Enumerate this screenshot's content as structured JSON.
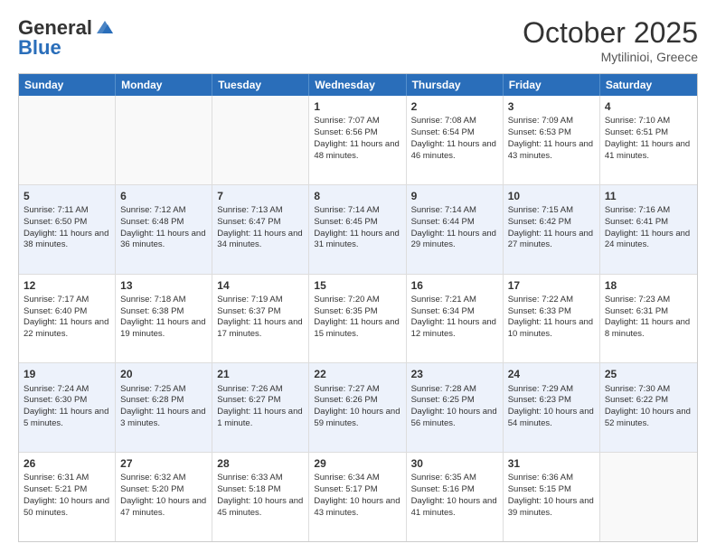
{
  "logo": {
    "general": "General",
    "blue": "Blue"
  },
  "header": {
    "month": "October 2025",
    "location": "Mytilinioi, Greece"
  },
  "days": [
    "Sunday",
    "Monday",
    "Tuesday",
    "Wednesday",
    "Thursday",
    "Friday",
    "Saturday"
  ],
  "rows": [
    [
      {
        "num": "",
        "info": ""
      },
      {
        "num": "",
        "info": ""
      },
      {
        "num": "",
        "info": ""
      },
      {
        "num": "1",
        "info": "Sunrise: 7:07 AM\nSunset: 6:56 PM\nDaylight: 11 hours and 48 minutes."
      },
      {
        "num": "2",
        "info": "Sunrise: 7:08 AM\nSunset: 6:54 PM\nDaylight: 11 hours and 46 minutes."
      },
      {
        "num": "3",
        "info": "Sunrise: 7:09 AM\nSunset: 6:53 PM\nDaylight: 11 hours and 43 minutes."
      },
      {
        "num": "4",
        "info": "Sunrise: 7:10 AM\nSunset: 6:51 PM\nDaylight: 11 hours and 41 minutes."
      }
    ],
    [
      {
        "num": "5",
        "info": "Sunrise: 7:11 AM\nSunset: 6:50 PM\nDaylight: 11 hours and 38 minutes."
      },
      {
        "num": "6",
        "info": "Sunrise: 7:12 AM\nSunset: 6:48 PM\nDaylight: 11 hours and 36 minutes."
      },
      {
        "num": "7",
        "info": "Sunrise: 7:13 AM\nSunset: 6:47 PM\nDaylight: 11 hours and 34 minutes."
      },
      {
        "num": "8",
        "info": "Sunrise: 7:14 AM\nSunset: 6:45 PM\nDaylight: 11 hours and 31 minutes."
      },
      {
        "num": "9",
        "info": "Sunrise: 7:14 AM\nSunset: 6:44 PM\nDaylight: 11 hours and 29 minutes."
      },
      {
        "num": "10",
        "info": "Sunrise: 7:15 AM\nSunset: 6:42 PM\nDaylight: 11 hours and 27 minutes."
      },
      {
        "num": "11",
        "info": "Sunrise: 7:16 AM\nSunset: 6:41 PM\nDaylight: 11 hours and 24 minutes."
      }
    ],
    [
      {
        "num": "12",
        "info": "Sunrise: 7:17 AM\nSunset: 6:40 PM\nDaylight: 11 hours and 22 minutes."
      },
      {
        "num": "13",
        "info": "Sunrise: 7:18 AM\nSunset: 6:38 PM\nDaylight: 11 hours and 19 minutes."
      },
      {
        "num": "14",
        "info": "Sunrise: 7:19 AM\nSunset: 6:37 PM\nDaylight: 11 hours and 17 minutes."
      },
      {
        "num": "15",
        "info": "Sunrise: 7:20 AM\nSunset: 6:35 PM\nDaylight: 11 hours and 15 minutes."
      },
      {
        "num": "16",
        "info": "Sunrise: 7:21 AM\nSunset: 6:34 PM\nDaylight: 11 hours and 12 minutes."
      },
      {
        "num": "17",
        "info": "Sunrise: 7:22 AM\nSunset: 6:33 PM\nDaylight: 11 hours and 10 minutes."
      },
      {
        "num": "18",
        "info": "Sunrise: 7:23 AM\nSunset: 6:31 PM\nDaylight: 11 hours and 8 minutes."
      }
    ],
    [
      {
        "num": "19",
        "info": "Sunrise: 7:24 AM\nSunset: 6:30 PM\nDaylight: 11 hours and 5 minutes."
      },
      {
        "num": "20",
        "info": "Sunrise: 7:25 AM\nSunset: 6:28 PM\nDaylight: 11 hours and 3 minutes."
      },
      {
        "num": "21",
        "info": "Sunrise: 7:26 AM\nSunset: 6:27 PM\nDaylight: 11 hours and 1 minute."
      },
      {
        "num": "22",
        "info": "Sunrise: 7:27 AM\nSunset: 6:26 PM\nDaylight: 10 hours and 59 minutes."
      },
      {
        "num": "23",
        "info": "Sunrise: 7:28 AM\nSunset: 6:25 PM\nDaylight: 10 hours and 56 minutes."
      },
      {
        "num": "24",
        "info": "Sunrise: 7:29 AM\nSunset: 6:23 PM\nDaylight: 10 hours and 54 minutes."
      },
      {
        "num": "25",
        "info": "Sunrise: 7:30 AM\nSunset: 6:22 PM\nDaylight: 10 hours and 52 minutes."
      }
    ],
    [
      {
        "num": "26",
        "info": "Sunrise: 6:31 AM\nSunset: 5:21 PM\nDaylight: 10 hours and 50 minutes."
      },
      {
        "num": "27",
        "info": "Sunrise: 6:32 AM\nSunset: 5:20 PM\nDaylight: 10 hours and 47 minutes."
      },
      {
        "num": "28",
        "info": "Sunrise: 6:33 AM\nSunset: 5:18 PM\nDaylight: 10 hours and 45 minutes."
      },
      {
        "num": "29",
        "info": "Sunrise: 6:34 AM\nSunset: 5:17 PM\nDaylight: 10 hours and 43 minutes."
      },
      {
        "num": "30",
        "info": "Sunrise: 6:35 AM\nSunset: 5:16 PM\nDaylight: 10 hours and 41 minutes."
      },
      {
        "num": "31",
        "info": "Sunrise: 6:36 AM\nSunset: 5:15 PM\nDaylight: 10 hours and 39 minutes."
      },
      {
        "num": "",
        "info": ""
      }
    ]
  ]
}
